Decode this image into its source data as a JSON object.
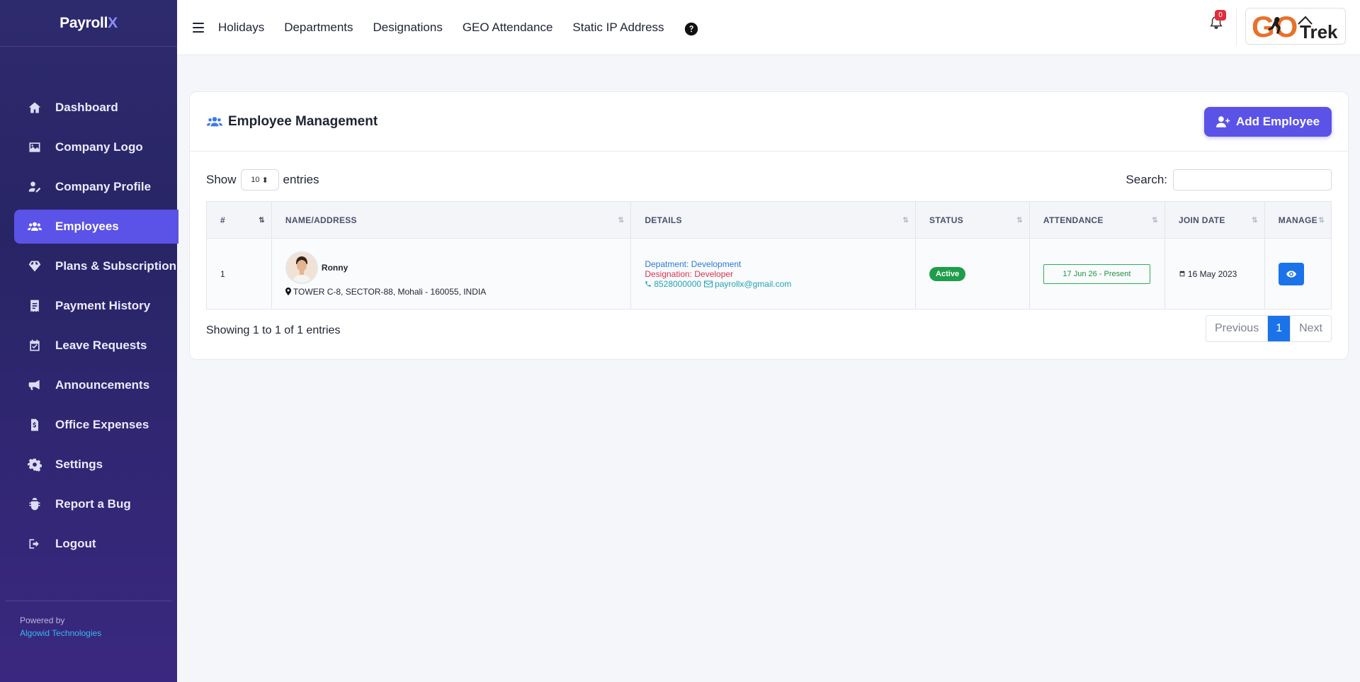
{
  "brand": {
    "name_main": "Payroll",
    "name_accent": "X"
  },
  "sidebar": {
    "items": [
      {
        "label": "Dashboard",
        "icon": "home-icon"
      },
      {
        "label": "Company Logo",
        "icon": "image-icon"
      },
      {
        "label": "Company Profile",
        "icon": "user-edit-icon"
      },
      {
        "label": "Employees",
        "icon": "users-icon",
        "active": true
      },
      {
        "label": "Plans & Subscription",
        "icon": "gem-icon"
      },
      {
        "label": "Payment History",
        "icon": "receipt-icon"
      },
      {
        "label": "Leave Requests",
        "icon": "calendar-check-icon"
      },
      {
        "label": "Announcements",
        "icon": "bullhorn-icon"
      },
      {
        "label": "Office Expenses",
        "icon": "file-invoice-dollar-icon"
      },
      {
        "label": "Settings",
        "icon": "gear-icon"
      },
      {
        "label": "Report a Bug",
        "icon": "bug-icon"
      },
      {
        "label": "Logout",
        "icon": "sign-out-icon"
      }
    ],
    "footer": {
      "powered_by": "Powered by",
      "company": "Algowid Technologies"
    }
  },
  "topbar": {
    "links": [
      "Holidays",
      "Departments",
      "Designations",
      "GEO Attendance",
      "Static IP Address"
    ],
    "notification_count": "0",
    "logo_text_go": "GO",
    "logo_text_trek": "Trek"
  },
  "card": {
    "title": "Employee Management",
    "add_button": "Add Employee",
    "show_label": "Show",
    "entries_label": "entries",
    "entries_value": "10",
    "search_label": "Search:",
    "search_value": ""
  },
  "table": {
    "headers": [
      "#",
      "NAME/ADDRESS",
      "DETAILS",
      "STATUS",
      "ATTENDANCE",
      "JOIN DATE",
      "MANAGE"
    ],
    "rows": [
      {
        "index": "1",
        "name": "Ronny",
        "address": "TOWER C-8, SECTOR-88, Mohali - 160055, INDIA",
        "department": "Depatment: Development",
        "designation": "Designation: Developer",
        "phone": "8528000000",
        "email": "payrollx@gmail.com",
        "status": "Active",
        "attendance": "17 Jun 26 - Present",
        "join_date": "16 May 2023"
      }
    ]
  },
  "footer": {
    "showing": "Showing 1 to 1 of 1 entries",
    "prev": "Previous",
    "page": "1",
    "next": "Next"
  },
  "colors": {
    "sidebar": "#2e2a6e",
    "accent": "#5b52e8",
    "active_badge": "#1e9e4a",
    "primary": "#1a73e8"
  }
}
